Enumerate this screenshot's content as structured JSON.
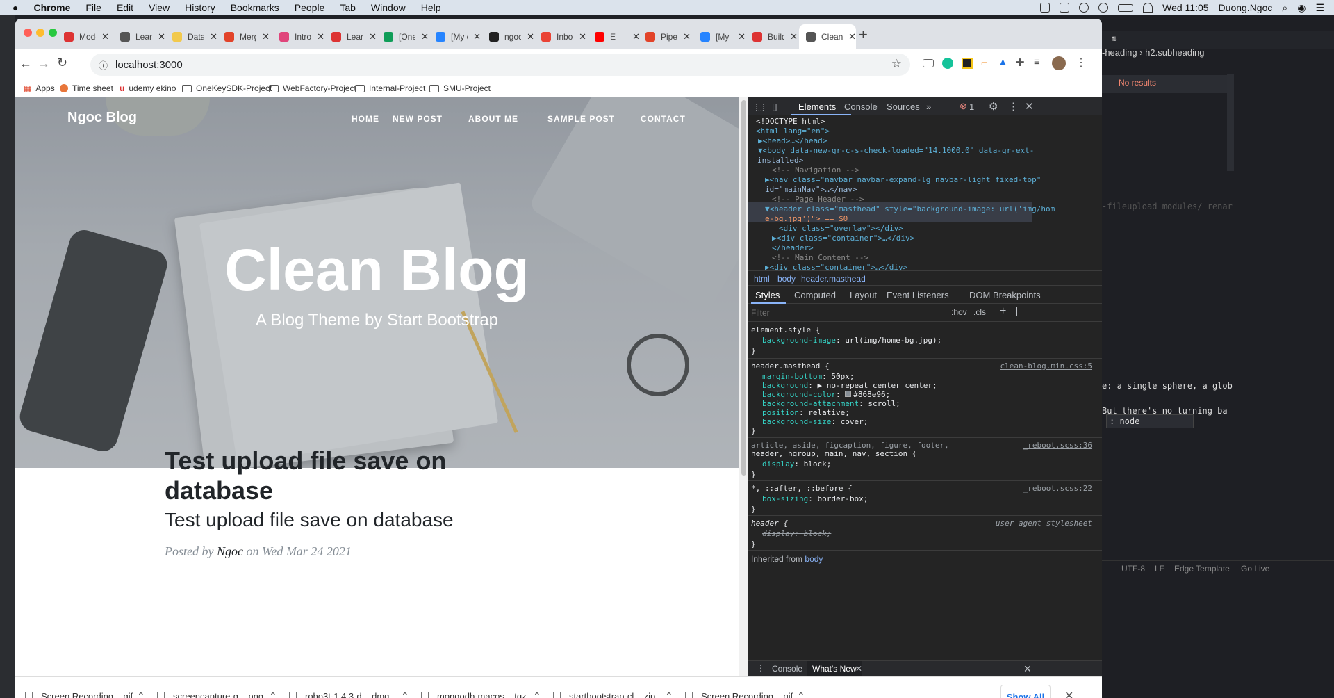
{
  "menubar": {
    "app": "Chrome",
    "items": [
      "File",
      "Edit",
      "View",
      "History",
      "Bookmarks",
      "People",
      "Tab",
      "Window",
      "Help"
    ],
    "clock": "Wed 11:05",
    "user": "Duong.Ngoc"
  },
  "tabs": [
    {
      "label": "Mode",
      "color": "#d33"
    },
    {
      "label": "Learn",
      "color": "#555"
    },
    {
      "label": "Data",
      "color": "#f2c94c"
    },
    {
      "label": "Merg",
      "color": "#e24329"
    },
    {
      "label": "Intro",
      "color": "#e0457b"
    },
    {
      "label": "Learn",
      "color": "#d33"
    },
    {
      "label": "[One",
      "color": "#0f9d58"
    },
    {
      "label": "[My c",
      "color": "#2684ff"
    },
    {
      "label": "ngoc",
      "color": "#222"
    },
    {
      "label": "Inbox",
      "color": "#ea4335"
    },
    {
      "label": "E",
      "color": "#f00"
    },
    {
      "label": "Pipel",
      "color": "#e24329"
    },
    {
      "label": "[My c",
      "color": "#2684ff"
    },
    {
      "label": "Build",
      "color": "#d33"
    },
    {
      "label": "Clean",
      "color": "#555"
    }
  ],
  "omnibox": {
    "url": "localhost:3000"
  },
  "bookmarks": {
    "apps": "Apps",
    "items": [
      "Time sheet",
      "udemy ekino",
      "OneKeySDK-Project",
      "WebFactory-Project",
      "Internal-Project",
      "SMU-Project"
    ]
  },
  "site": {
    "brand": "Ngoc Blog",
    "nav": [
      "HOME",
      "NEW POST",
      "ABOUT ME",
      "SAMPLE POST",
      "CONTACT"
    ],
    "hero_title": "Clean Blog",
    "hero_subtitle": "A Blog Theme by Start Bootstrap",
    "post": {
      "title": "Test upload file save on database",
      "subtitle": "Test upload file save on database",
      "posted_by": "Posted by",
      "author": "Ngoc",
      "on": "on",
      "date": "Wed Mar 24 2021"
    }
  },
  "devtools": {
    "tabs": [
      "Elements",
      "Console",
      "Sources"
    ],
    "more": "»",
    "error_count": "1",
    "dom": [
      "<!DOCTYPE html>",
      "<html lang=\"en\">",
      "▶<head>…</head>",
      "▼<body data-new-gr-c-s-check-loaded=\"14.1000.0\" data-gr-ext-",
      "installed>",
      "<!-- Navigation -->",
      "▶<nav class=\"navbar navbar-expand-lg navbar-light fixed-top\"",
      "id=\"mainNav\">…</nav>",
      "<!-- Page Header -->",
      "▼<header class=\"masthead\" style=\"background-image: url('img/hom",
      "e-bg.jpg')\"> == $0",
      "<div class=\"overlay\"></div>",
      "▶<div class=\"container\">…</div>",
      "</header>",
      "<!-- Main Content -->",
      "▶<div class=\"container\">…</div>"
    ],
    "breadcrumbs": [
      "html",
      "body",
      "header.masthead"
    ],
    "subtabs": [
      "Styles",
      "Computed",
      "Layout",
      "Event Listeners",
      "DOM Breakpoints"
    ],
    "filter_placeholder": "Filter",
    "hov": ":hov",
    "cls": ".cls",
    "rules": {
      "r1_sel": "element.style {",
      "r1_p1": "background-image",
      "r1_v1": "url(img/home-bg.jpg);",
      "r2_sel": "header.masthead {",
      "r2_src": "clean-blog.min.css:5",
      "r2_props": [
        {
          "n": "margin-bottom",
          "v": "50px;"
        },
        {
          "n": "background",
          "v": "▶ no-repeat center center;"
        },
        {
          "n": "background-color",
          "v": "#868e96;"
        },
        {
          "n": "background-attachment",
          "v": "scroll;"
        },
        {
          "n": "position",
          "v": "relative;"
        },
        {
          "n": "background-size",
          "v": "cover;"
        }
      ],
      "r3_sel": "article, aside, figcaption, figure, footer,",
      "r3_sel2": "header, hgroup, main, nav, section {",
      "r3_src": "_reboot.scss:36",
      "r3_p": "display",
      "r3_v": "block;",
      "r4_sel": "*, ::after, ::before {",
      "r4_src": "_reboot.scss:22",
      "r4_p": "box-sizing",
      "r4_v": "border-box;",
      "r5_sel": "header {",
      "r5_src": "user agent stylesheet",
      "r5_p": "display: block;",
      "close": "}",
      "inherited": "Inherited from",
      "inherited_el": "body"
    },
    "drawer_tabs": [
      "Console",
      "What's New"
    ]
  },
  "downloads": [
    "Screen Recording....gif",
    "screencapture-g....png",
    "robo3t-1.4.3-d....dmg",
    "mongodb-macos....tgz",
    "startbootstrap-cl....zip",
    "Screen Recording....gif"
  ],
  "downloads_show_all": "Show All",
  "editor": {
    "breadcrumb": "-heading",
    "breadcrumb2": "h2.subheading",
    "search_status": "No results",
    "code1": "-fileupload modules/ renar",
    "code2": "e: a single sphere, a glob",
    "code3": "But there's no turning ba",
    "terminal_select": ": node",
    "status": [
      "UTF-8",
      "LF",
      "Edge Template",
      "Go Live"
    ]
  }
}
